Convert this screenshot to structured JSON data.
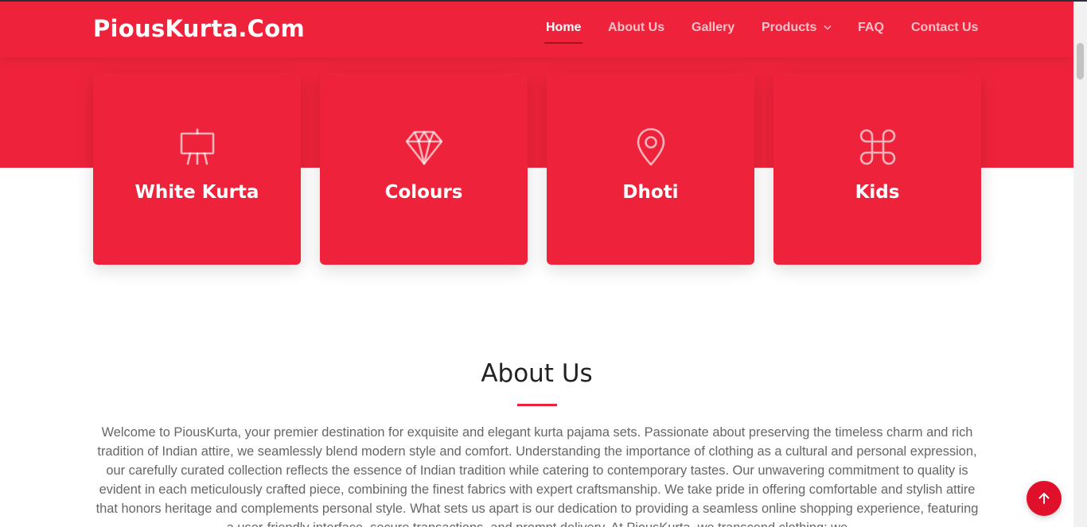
{
  "site": {
    "logo": "PiousKurta.Com"
  },
  "nav": {
    "items": [
      {
        "label": "Home",
        "active": true
      },
      {
        "label": "About Us"
      },
      {
        "label": "Gallery"
      },
      {
        "label": "Products",
        "dropdown": true
      },
      {
        "label": "FAQ"
      },
      {
        "label": "Contact Us"
      }
    ]
  },
  "cards": [
    {
      "label": "White Kurta",
      "icon": "easel-icon"
    },
    {
      "label": "Colours",
      "icon": "gem-icon"
    },
    {
      "label": "Dhoti",
      "icon": "map-pin-icon"
    },
    {
      "label": "Kids",
      "icon": "command-icon"
    }
  ],
  "about": {
    "title": "About Us",
    "text": "Welcome to PiousKurta, your premier destination for exquisite and elegant kurta pajama sets. Passionate about preserving the timeless charm and rich tradition of Indian attire, we seamlessly blend modern style and comfort. Understanding the importance of clothing as a cultural and personal expression, our carefully curated collection reflects the essence of Indian tradition while catering to contemporary tastes. Our unwavering commitment to quality is evident in each meticulously crafted piece, combining the finest fabrics with expert craftsmanship. We take pride in offering comfortable and stylish attire that honors heritage and complements personal style. What sets us apart is our dedication to providing a seamless online shopping experience, featuring a user-friendly interface, secure transactions, and prompt delivery. At PiousKurta, we transcend clothing; we"
  },
  "colors": {
    "brand": "#ee233b",
    "accent_dark": "#a8101f",
    "text": "#666666",
    "heading": "#222222"
  },
  "back_to_top_icon": "arrow-up-icon"
}
